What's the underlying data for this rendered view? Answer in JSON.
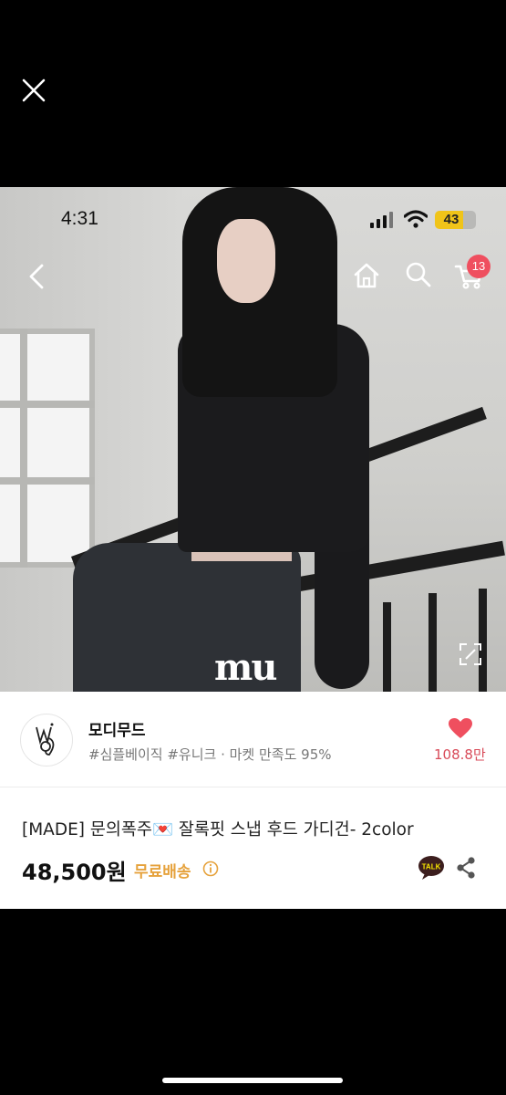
{
  "status_bar": {
    "time": "4:31",
    "battery": "43"
  },
  "cart": {
    "count": "13"
  },
  "photo": {
    "watermark": "mu"
  },
  "shop": {
    "name": "모디무드",
    "tags": "#심플베이직 #유니크 · 마켓 만족도 95%",
    "likes": "108.8만"
  },
  "product": {
    "title": "[MADE] 문의폭주💌  잘록핏 스냅 후드 가디건- 2color",
    "price": "48,500원",
    "shipping": "무료배송"
  },
  "icons": {
    "close": "close-icon",
    "back": "chevron-left-icon",
    "home": "home-icon",
    "search": "search-icon",
    "cart": "cart-icon",
    "expand": "expand-icon",
    "heart": "heart-icon",
    "info": "info-icon",
    "talk": "kakao-talk-icon",
    "share": "share-icon"
  },
  "colors": {
    "accent_red": "#ef4f5f",
    "like_text": "#d84a58",
    "shipping_orange": "#e6a23c",
    "battery_yellow": "#f0c419"
  }
}
